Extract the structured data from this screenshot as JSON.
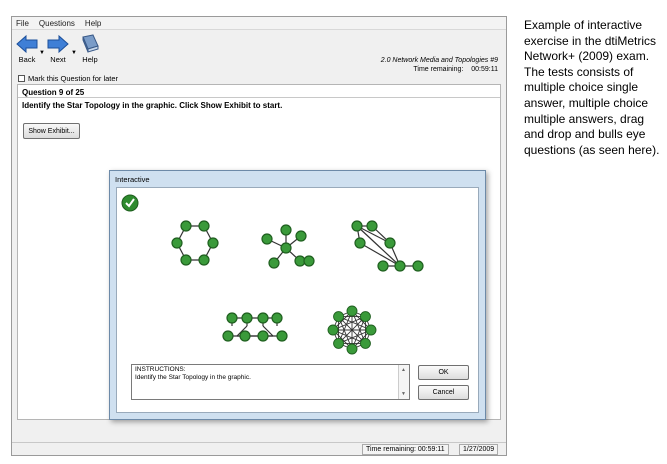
{
  "menu": [
    "File",
    "Questions",
    "Help"
  ],
  "toolbar": {
    "back_label": "Back",
    "next_label": "Next",
    "help_label": "Help"
  },
  "exam": {
    "section": "2.0 Network Media and Topologies #9",
    "time_label": "Time remaining:",
    "time_value": "00:59:11"
  },
  "mark_label": "Mark this Question for later",
  "question": {
    "number": "Question 9 of 25",
    "text": "Identify the Star Topology in the graphic. Click Show Exhibit to start."
  },
  "show_exhibit_label": "Show Exhibit...",
  "dialog": {
    "title": "Interactive",
    "instructions_heading": "INSTRUCTIONS:",
    "instructions_text": "Identify the Star Topology in the graphic.",
    "ok_label": "OK",
    "cancel_label": "Cancel"
  },
  "status": {
    "time": "Time remaining: 00:59:11",
    "date": "1/27/2009"
  },
  "colors": {
    "node_green": "#3a9a3a",
    "check_green": "#2e8b2e",
    "dialog_frame": "#cfe0f0"
  },
  "caption": "Example of interactive exercise in the dtiMetrics Network+ (2009) exam. The tests consists of multiple choice single answer, multiple choice multiple answers, drag and drop and bulls eye questions (as seen here)."
}
